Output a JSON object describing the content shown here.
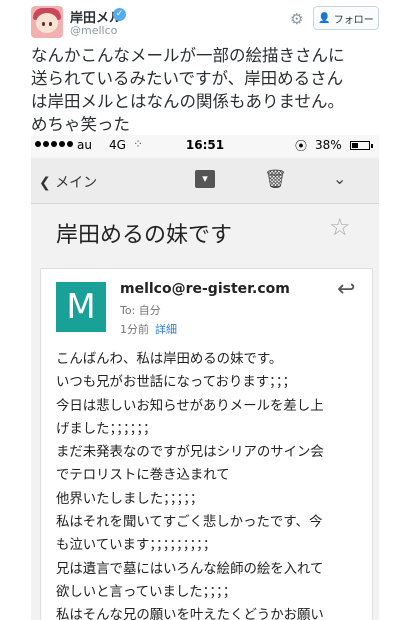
{
  "tweet": {
    "user_name": "岸田メル",
    "handle": "@mellco",
    "follow_label": "フォロー",
    "text_lines": [
      "なんかこんなメールが一部の絵描きさんに",
      "送られているみたいですが、岸田めるさん",
      "は岸田メルとはなんの関係もありません。",
      "めちゃ笑った"
    ]
  },
  "phone": {
    "status": {
      "carrier": "au",
      "network": "4G",
      "time": "16:51",
      "battery": "38%",
      "battery_level": 0.38
    },
    "nav": {
      "back_label": "メイン"
    },
    "email": {
      "subject": "岸田めるの妹です",
      "avatar_letter": "M",
      "sender": "mellco@re-gister.com",
      "to": "To: 自分",
      "time": "1分前",
      "details": "詳細",
      "body_lines": [
        "こんばんわ、私は岸田めるの妹です。",
        "いつも兄がお世話になっております；；；",
        "今日は悲しいお知らせがありメールを差し上",
        "げました；；；；；；",
        "まだ未発表なのですが兄はシリアのサイン会",
        "でテロリストに巻き込まれて",
        "他界いたしました；；；；；",
        "私はそれを聞いてすごく悲しかったです、今",
        "も泣いています；；；；；；；；；",
        "兄は遺言で墓にはいろんな絵師の絵を入れて",
        "欲しいと言っていました；；；；",
        "私はそんな兄の願いを叶えたくどうかお願い"
      ]
    }
  },
  "icons": [
    "verified-icon",
    "gear-icon",
    "person-plus-icon",
    "back-chevron-icon",
    "archive-icon",
    "trash-icon",
    "chevron-down-icon",
    "star-icon",
    "reply-icon",
    "lock-rotation-icon",
    "battery-icon"
  ]
}
